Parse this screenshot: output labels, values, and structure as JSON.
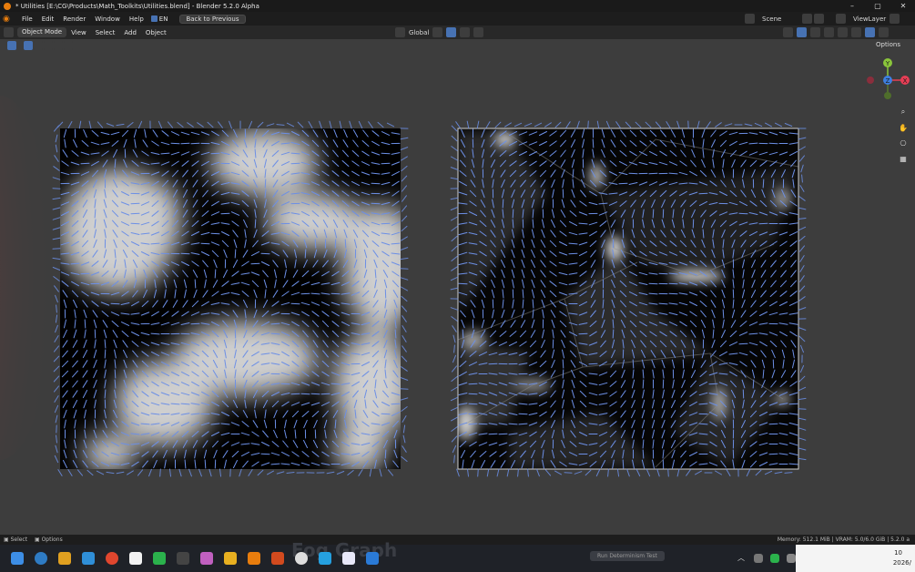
{
  "window": {
    "title": "* Utilities [E:\\CG\\Products\\Math_Toolkits\\Utilities.blend] - Blender 5.2.0 Alpha",
    "minimize": "–",
    "maximize": "▢",
    "close": "✕"
  },
  "menubar": {
    "items": [
      "File",
      "Edit",
      "Render",
      "Window",
      "Help"
    ],
    "lang": "EN",
    "back_button": "Back to Previous",
    "scene_label": "Scene",
    "view_layer_label": "ViewLayer"
  },
  "header3d": {
    "mode": "Object Mode",
    "menus": [
      "View",
      "Select",
      "Add",
      "Object"
    ],
    "transform_orientation": "Global",
    "options": "Options"
  },
  "gizmo": {
    "y_label": "Y",
    "z_label": "Z",
    "x_label": "X",
    "colors": {
      "x": "#e63e55",
      "y": "#8ac53b",
      "z": "#3d7fe0"
    }
  },
  "viewport": {
    "left_panel": "perlin-noise-flow-field",
    "right_panel": "voronoi-gradient-flow-field",
    "arrow_color": "#6c8fe6"
  },
  "statusbar": {
    "select": "Select",
    "options": "Options",
    "info": "Memory: 512.1 MiB | VRAM: 5.0/6.0 GiB | 5.2.0 a"
  },
  "taskbar": {
    "ghost_title": "Fog Graph",
    "run_button": "Run Determinism Test",
    "clock_time": "10",
    "clock_date": "2026/"
  }
}
